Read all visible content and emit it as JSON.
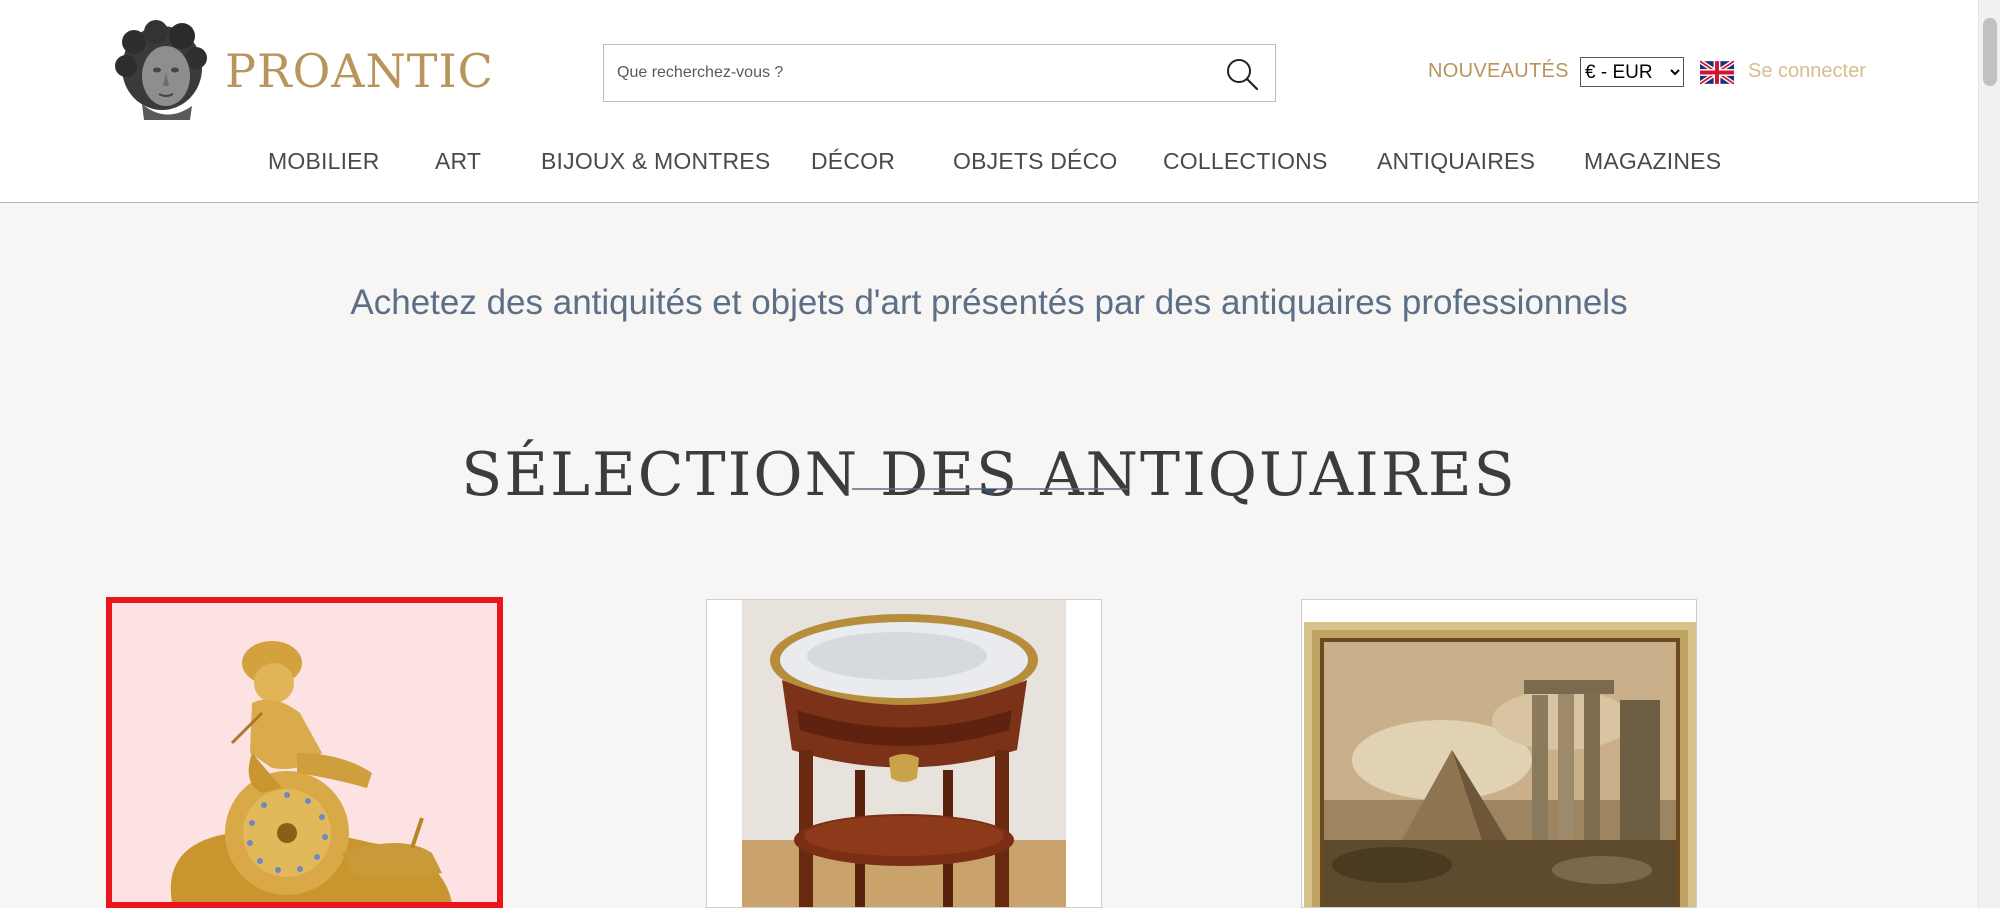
{
  "header": {
    "brand": "PROANTIC",
    "search_placeholder": "Que recherchez-vous ?",
    "new_link": "NOUVEAUTÉS",
    "currency": "€ - EUR",
    "login": "Se connecter"
  },
  "nav": [
    "MOBILIER",
    "ART",
    "BIJOUX & MONTRES",
    "DÉCOR",
    "OBJETS DÉCO",
    "COLLECTIONS",
    "ANTIQUAIRES",
    "MAGAZINES"
  ],
  "main": {
    "tagline": "Achetez des antiquités et objets d'art présentés par des antiquaires professionnels",
    "section_title": "SÉLECTION DES ANTIQUAIRES"
  },
  "products": [
    {
      "icon": "gilt-bronze-clock-image",
      "selected": true
    },
    {
      "icon": "side-table-image",
      "selected": false
    },
    {
      "icon": "ruins-painting-image",
      "selected": false
    }
  ],
  "colors": {
    "gold": "#b8955a",
    "tagline": "#5b6f87",
    "selection": "#e8161c",
    "background": "#f7f6f4"
  }
}
